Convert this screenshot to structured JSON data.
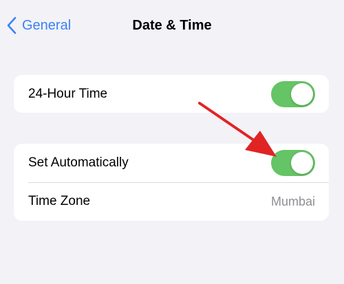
{
  "nav": {
    "back_label": "General",
    "title": "Date & Time"
  },
  "group1": {
    "row_label": "24-Hour Time",
    "toggle_on": true
  },
  "group2": {
    "auto_label": "Set Automatically",
    "auto_toggle_on": true,
    "timezone_label": "Time Zone",
    "timezone_value": "Mumbai"
  },
  "colors": {
    "accent": "#3b82f6",
    "toggle_on": "#65c466",
    "background": "#f2f2f7",
    "secondary_text": "#8e8e93",
    "annotation_arrow": "#e02424"
  }
}
